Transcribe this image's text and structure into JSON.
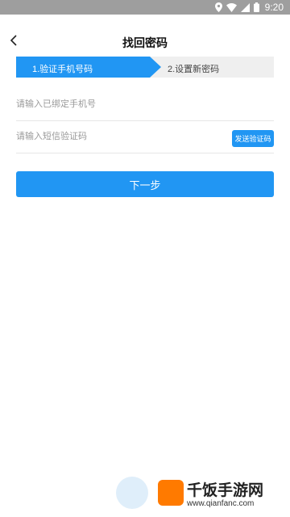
{
  "status_bar": {
    "time": "9:20"
  },
  "header": {
    "title": "找回密码",
    "back_icon": "chevron-left-icon"
  },
  "steps": [
    {
      "label": "1.验证手机号码",
      "active": true
    },
    {
      "label": "2.设置新密码",
      "active": false
    }
  ],
  "form": {
    "phone_placeholder": "请输入已绑定手机号",
    "code_placeholder": "请输入短信验证码",
    "send_code_label": "发送验证码"
  },
  "next_button": {
    "label": "下一步"
  },
  "watermark": {
    "text": "千饭手游网",
    "url": "www.qianfanc.com"
  },
  "colors": {
    "accent": "#2196f3",
    "status_bar": "#9e9e9e",
    "step_inactive": "#efefef"
  }
}
